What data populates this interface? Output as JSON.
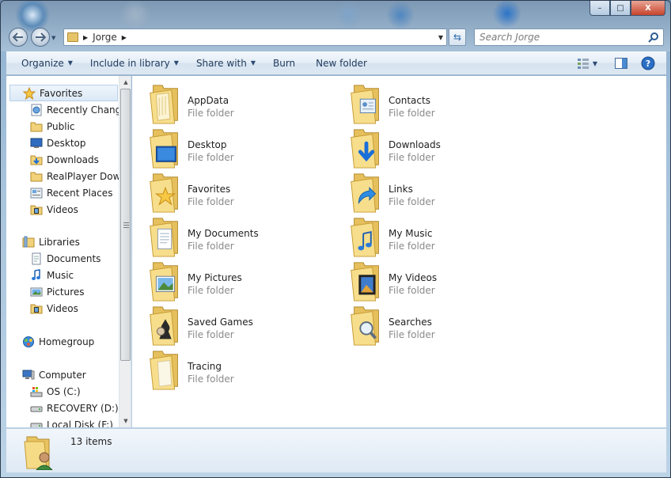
{
  "window": {
    "caption_buttons": {
      "minimize": "–",
      "maximize": "□",
      "close": "X"
    }
  },
  "address_bar": {
    "path": [
      "Jorge"
    ],
    "arrow": "▶",
    "dropdown": "▼",
    "refresh": "⇆"
  },
  "search": {
    "placeholder": "Search Jorge"
  },
  "toolbar": {
    "organize": "Organize",
    "include_in_library": "Include in library",
    "share_with": "Share with",
    "burn": "Burn",
    "new_folder": "New folder",
    "caret": "▼",
    "views_caret": "▼"
  },
  "nav_pane": {
    "favorites_header": "Favorites",
    "favorites": [
      {
        "label": "Recently Changed",
        "icon": "recent-changes-icon"
      },
      {
        "label": "Public",
        "icon": "folder-icon"
      },
      {
        "label": "Desktop",
        "icon": "desktop-icon"
      },
      {
        "label": "Downloads",
        "icon": "downloads-icon"
      },
      {
        "label": "RealPlayer Downloads",
        "icon": "folder-icon"
      },
      {
        "label": "Recent Places",
        "icon": "recent-places-icon"
      },
      {
        "label": "Videos",
        "icon": "videos-icon"
      }
    ],
    "libraries_header": "Libraries",
    "libraries": [
      {
        "label": "Documents",
        "icon": "documents-icon"
      },
      {
        "label": "Music",
        "icon": "music-icon"
      },
      {
        "label": "Pictures",
        "icon": "pictures-icon"
      },
      {
        "label": "Videos",
        "icon": "videos-icon"
      }
    ],
    "homegroup": "Homegroup",
    "computer_header": "Computer",
    "drives": [
      {
        "label": "OS (C:)",
        "icon": "os-drive-icon"
      },
      {
        "label": "RECOVERY (D:)",
        "icon": "drive-icon"
      },
      {
        "label": "Local Disk (F:)",
        "icon": "drive-icon"
      }
    ]
  },
  "folders": [
    {
      "name": "AppData",
      "type": "File folder",
      "overlay": "appdata"
    },
    {
      "name": "Contacts",
      "type": "File folder",
      "overlay": "contacts"
    },
    {
      "name": "Desktop",
      "type": "File folder",
      "overlay": "desktop"
    },
    {
      "name": "Downloads",
      "type": "File folder",
      "overlay": "downloads"
    },
    {
      "name": "Favorites",
      "type": "File folder",
      "overlay": "favorites"
    },
    {
      "name": "Links",
      "type": "File folder",
      "overlay": "links"
    },
    {
      "name": "My Documents",
      "type": "File folder",
      "overlay": "documents"
    },
    {
      "name": "My Music",
      "type": "File folder",
      "overlay": "music"
    },
    {
      "name": "My Pictures",
      "type": "File folder",
      "overlay": "pictures"
    },
    {
      "name": "My Videos",
      "type": "File folder",
      "overlay": "videos"
    },
    {
      "name": "Saved Games",
      "type": "File folder",
      "overlay": "games"
    },
    {
      "name": "Searches",
      "type": "File folder",
      "overlay": "searches"
    },
    {
      "name": "Tracing",
      "type": "File folder",
      "overlay": "blank"
    }
  ],
  "details_pane": {
    "item_count": "13 items"
  },
  "colors": {
    "folder_yellow": "#f2d57a",
    "folder_dark": "#c99a2e",
    "accent_blue": "#1e395b",
    "secondary_text": "#8a8a8a"
  }
}
